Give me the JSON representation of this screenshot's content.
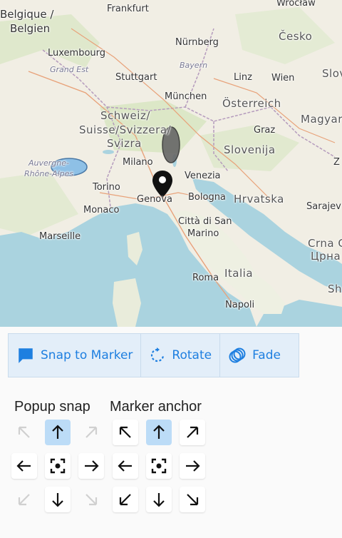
{
  "map": {
    "labels": {
      "belgique": "Belgique /",
      "belgien": "Belgien",
      "frankfurt": "Frankfurt",
      "wroclaw": "Wrocław",
      "nurnberg": "Nürnberg",
      "cesko": "Česko",
      "luxembourg": "Luxembourg",
      "grand_est": "Grand Est",
      "bayern": "Bayern",
      "linz": "Linz",
      "stuttgart": "Stuttgart",
      "wien": "Wien",
      "slov": "Slov",
      "munchen": "München",
      "osterreich": "Österreich",
      "magyar": "Magyar",
      "schweiz": "Schweiz/",
      "suisse": "Suisse/Svizzera/",
      "svizra": "Svizra",
      "graz": "Graz",
      "slovenija": "Slovenija",
      "auvergne": "Auvergne-",
      "rhone": "Rhône-Alpes",
      "milano": "Milano",
      "venezia": "Venezia",
      "zagreb": "Z",
      "torino": "Torino",
      "genova": "Genova",
      "bologna": "Bologna",
      "hrvatska": "Hrvatska",
      "sarajevo": "Sarajev",
      "monaco": "Monaco",
      "citta": "Città di San",
      "marino": "Marino",
      "marseille": "Marseille",
      "crna": "Crna G",
      "crna2": "Црна",
      "roma": "Roma",
      "italia": "Italia",
      "napoli": "Napoli",
      "sh": "Sh"
    }
  },
  "toolbar": {
    "snap_label": "Snap to Marker",
    "rotate_label": "Rotate",
    "fade_label": "Fade"
  },
  "popup_snap": {
    "title": "Popup snap",
    "selected": "up"
  },
  "marker_anchor": {
    "title": "Marker anchor",
    "selected": "up"
  },
  "colors": {
    "accent": "#1e7fe0",
    "selected": "#bcdcf7",
    "toolbar_bg": "#e3eef9"
  }
}
